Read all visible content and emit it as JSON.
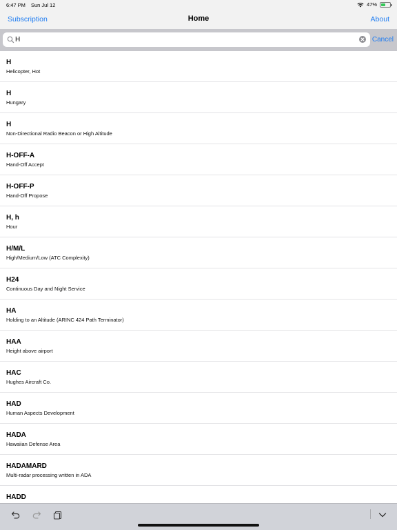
{
  "status_bar": {
    "time": "6:47 PM",
    "date": "Sun Jul 12",
    "battery": "47%",
    "battery_level": 0.47,
    "icons": [
      "wifi-icon",
      "battery-icon"
    ]
  },
  "nav": {
    "left_label": "Subscription",
    "title": "Home",
    "right_label": "About"
  },
  "search": {
    "value": "H",
    "placeholder": "",
    "cancel_label": "Cancel"
  },
  "items": [
    {
      "title": "H",
      "subtitle": "Helicopter, Hot"
    },
    {
      "title": "H",
      "subtitle": "Hungary"
    },
    {
      "title": "H",
      "subtitle": "Non-Directional Radio Beacon or High Altitude"
    },
    {
      "title": "H-OFF-A",
      "subtitle": "Hand-Off Accept"
    },
    {
      "title": "H-OFF-P",
      "subtitle": "Hand-Off Propose"
    },
    {
      "title": "H, h",
      "subtitle": "Hour"
    },
    {
      "title": "H/M/L",
      "subtitle": "High/Medium/Low (ATC Complexity)"
    },
    {
      "title": "H24",
      "subtitle": "Continuous Day and Night Service"
    },
    {
      "title": "HA",
      "subtitle": "Holding to an Altitude (ARINC 424 Path Terminator)"
    },
    {
      "title": "HAA",
      "subtitle": "Height above airport"
    },
    {
      "title": "HAC",
      "subtitle": "Hughes Aircraft Co."
    },
    {
      "title": "HAD",
      "subtitle": "Human Aspects Development"
    },
    {
      "title": "HADA",
      "subtitle": "Hawaiian Defense Area"
    },
    {
      "title": "HADAMARD",
      "subtitle": "Multi-radar processing written in ADA"
    },
    {
      "title": "HADD",
      "subtitle": ""
    }
  ],
  "toolbar": {
    "icons": [
      "undo-icon",
      "redo-icon",
      "paste-icon",
      "keyboard-dismiss-icon"
    ]
  },
  "colors": {
    "accent": "#1e7cf2",
    "bar_background": "#f2f2f2",
    "search_background": "#c7c7cc",
    "toolbar_background": "#d1d3d9"
  }
}
